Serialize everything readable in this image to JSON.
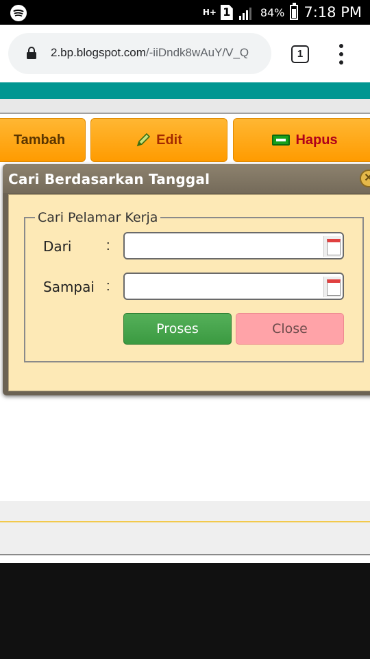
{
  "status_bar": {
    "network": "H+",
    "sim": "1",
    "battery": "84%",
    "time": "7:18 PM"
  },
  "browser": {
    "url_host": "2.bp.blogspot.com",
    "url_path": "/-iiDndk8wAuY/V_Q",
    "tab_count": "1"
  },
  "toolbar": {
    "add_label": "Tambah",
    "edit_label": "Edit",
    "delete_label": "Hapus"
  },
  "dialog": {
    "title": "Cari Berdasarkan Tanggal",
    "fieldset_legend": "Cari Pelamar Kerja",
    "from_label": "Dari",
    "to_label": "Sampai",
    "colon": ":",
    "from_value": "",
    "to_value": "",
    "process_label": "Proses",
    "close_label": "Close"
  },
  "colors": {
    "teal": "#009691",
    "toolbar_orange": "#ff9b00",
    "dialog_bg": "#fde9b6",
    "proses_green": "#3b9a41",
    "close_pink": "#ffa3a8"
  }
}
